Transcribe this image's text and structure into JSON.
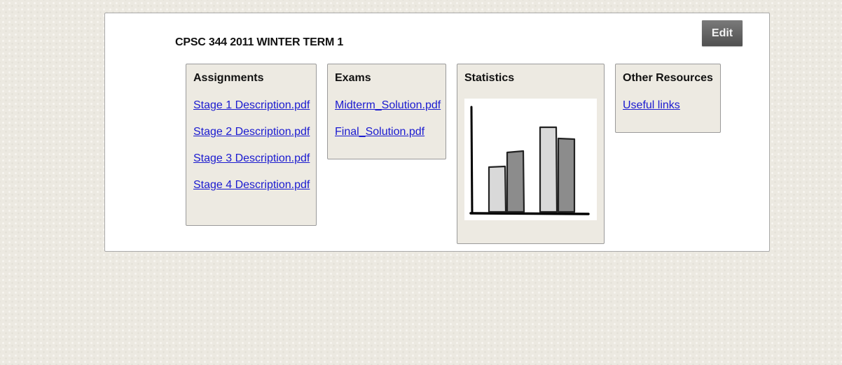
{
  "course": {
    "title": "CPSC 344 2011 WINTER TERM 1"
  },
  "toolbar": {
    "edit_label": "Edit"
  },
  "cards": {
    "assignments": {
      "title": "Assignments",
      "links": [
        "Stage 1 Description.pdf",
        "Stage 2 Description.pdf",
        "Stage 3 Description.pdf",
        "Stage 4 Description.pdf"
      ]
    },
    "exams": {
      "title": "Exams",
      "links": [
        "Midterm_Solution.pdf",
        "Final_Solution.pdf"
      ]
    },
    "statistics": {
      "title": "Statistics",
      "icon": "bar-chart-icon"
    },
    "resources": {
      "title": "Other Resources",
      "links": [
        "Useful links"
      ]
    }
  },
  "colors": {
    "link": "#1a1ad0",
    "card_background": "#edeae2",
    "button_background": "#606060",
    "bar_light": "#d9d9d9",
    "bar_dark": "#8c8c8c"
  }
}
